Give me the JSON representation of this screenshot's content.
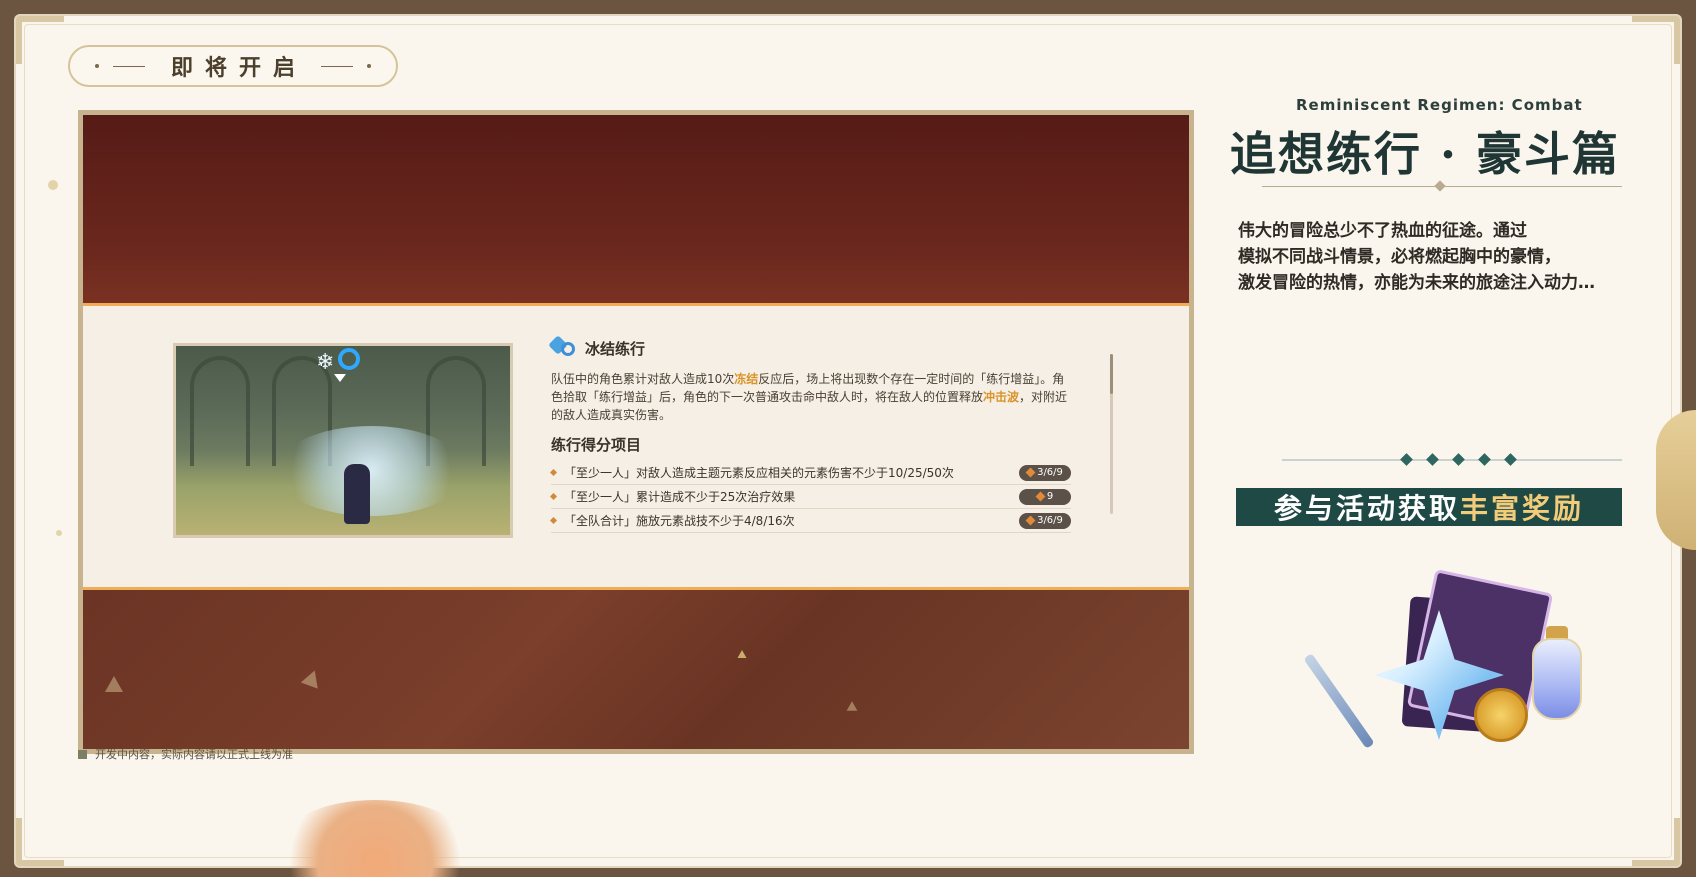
{
  "badge": {
    "label": "即将开启"
  },
  "preview": {
    "mode_title": "冰结练行",
    "description": {
      "part1": "队伍中的角色累计对敌人造成10次",
      "highlight1": "冻结",
      "part2": "反应后，场上将出现数个存在一定时间的「练行增益」。角色拾取「练行增益」后，角色的下一次普通攻击命中敌人时，将在敌人的位置释放",
      "highlight2": "冲击波",
      "part3": "，对附近的敌人造成真实伤害。"
    },
    "score_title": "练行得分项目",
    "score_items": [
      {
        "text": "「至少一人」对敌人造成主题元素反应相关的元素伤害不少于10/25/50次",
        "reward": "3/6/9"
      },
      {
        "text": "「至少一人」累计造成不少于25次治疗效果",
        "reward": "9"
      },
      {
        "text": "「全队合计」施放元素战技不少于4/8/16次",
        "reward": "3/6/9"
      }
    ]
  },
  "disclaimer": "开发中内容，实际内容请以正式上线为准",
  "event": {
    "title_en": "Reminiscent Regimen: Combat",
    "title_cn": "追想练行 · 豪斗篇",
    "intro": [
      "伟大的冒险总少不了热血的征途。通过",
      "模拟不同战斗情景，必将燃起胸中的豪情，",
      "激发冒险的热情，亦能为未来的旅途注入动力…"
    ],
    "reward_banner": {
      "prefix": "参与活动获取",
      "highlight": "丰富奖励"
    }
  },
  "colors": {
    "accent_orange": "#f0ad55",
    "highlight_text": "#d9942a",
    "banner_bg": "#1f4944",
    "banner_highlight": "#f2cc7a",
    "title_dark_green": "#1f3634"
  },
  "icons": {
    "mode_icon": "cryo-hydro-icon",
    "reward_chip_icon": "diamond-icon",
    "rewards": [
      "primogem-icon",
      "weapon-icon",
      "book-icon",
      "mora-coin-icon",
      "potion-bottle-icon"
    ]
  }
}
